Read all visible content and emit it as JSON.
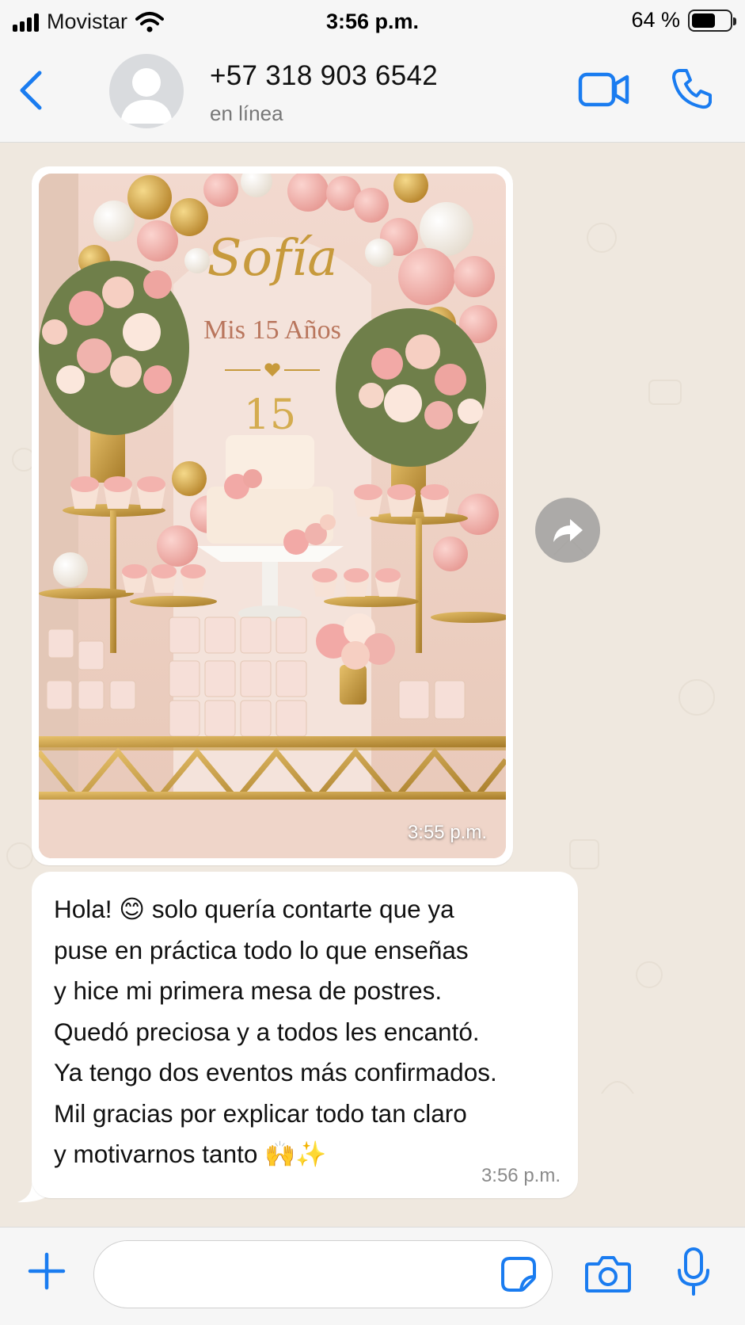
{
  "status_bar": {
    "carrier": "Movistar",
    "time": "3:56 p.m.",
    "battery_percent": "64 %",
    "battery_level": 0.64
  },
  "header": {
    "contact_name": "+57 318 903 6542",
    "contact_status": "en línea"
  },
  "chat": {
    "image_message": {
      "time": "3:55 p.m."
    },
    "text_message": {
      "lines": [
        "Hola! 😊 solo quería contarte que ya",
        "puse en práctica todo lo que enseñas",
        "y hice mi primera mesa de postres.",
        "Quedó preciosa y a todos les encantó.",
        "Ya tengo dos eventos más confirmados.",
        "Mil gracias por explicar todo tan claro",
        "y motivarnos tanto 🙌✨"
      ],
      "time": "3:56 p.m."
    }
  },
  "photo": {
    "name": "Sofía",
    "subtitle": "Mis 15 Años",
    "cake_topper": "15"
  },
  "colors": {
    "ios_blue": "#1a7cf0",
    "chat_bg": "#efe8df",
    "bar_bg": "#f6f6f6"
  },
  "icons": [
    "signal-icon",
    "wifi-icon",
    "battery-icon",
    "back-icon",
    "avatar-icon",
    "video-call-icon",
    "phone-icon",
    "forward-icon",
    "plus-icon",
    "sticker-icon",
    "camera-icon",
    "mic-icon"
  ]
}
